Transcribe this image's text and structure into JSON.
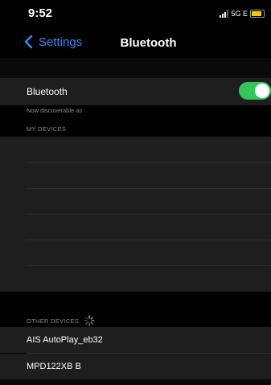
{
  "status_bar": {
    "time": "9:52",
    "network": "5G E"
  },
  "nav": {
    "back_label": "Settings",
    "title": "Bluetooth"
  },
  "bluetooth": {
    "label": "Bluetooth",
    "enabled": true,
    "toggle_color": "#31c75a"
  },
  "discoverable_text": "Now discoverable as",
  "my_devices": {
    "header": "MY DEVICES",
    "items": []
  },
  "other_devices": {
    "header": "OTHER DEVICES",
    "items": [
      {
        "label": "AIS AutoPlay_eb32"
      },
      {
        "label": "MPD122XB B"
      }
    ]
  },
  "colors": {
    "accent": "#2f8cff",
    "row_bg": "#1e1e1e",
    "background": "#000000"
  }
}
